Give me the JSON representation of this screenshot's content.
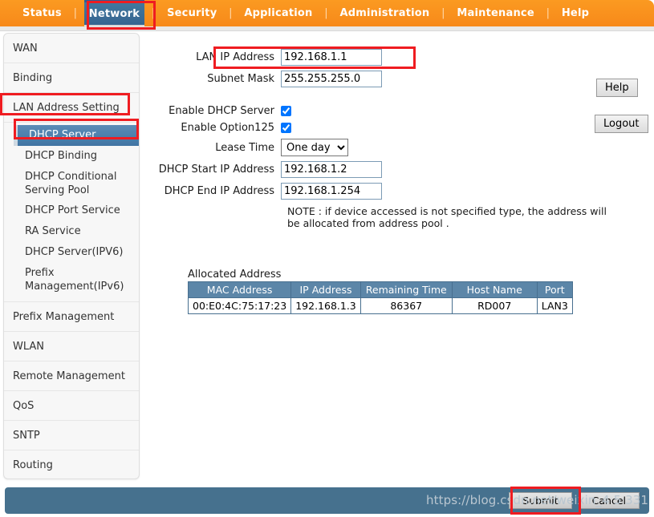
{
  "topnav": {
    "separator": "|",
    "items": [
      {
        "label": "Status",
        "active": false
      },
      {
        "label": "Network",
        "active": true
      },
      {
        "label": "Security",
        "active": false
      },
      {
        "label": "Application",
        "active": false
      },
      {
        "label": "Administration",
        "active": false
      },
      {
        "label": "Maintenance",
        "active": false
      },
      {
        "label": "Help",
        "active": false
      }
    ],
    "highlight_color": "#ef1c21",
    "bar_color": "#f7941e",
    "active_tab_color": "#3b72a4"
  },
  "sidebar": {
    "items": [
      {
        "label": "WAN"
      },
      {
        "label": "Binding"
      },
      {
        "label": "LAN Address Setting",
        "highlighted": true
      },
      {
        "label": "Prefix Management"
      },
      {
        "label": "WLAN"
      },
      {
        "label": "Remote Management"
      },
      {
        "label": "QoS"
      },
      {
        "label": "SNTP"
      },
      {
        "label": "Routing"
      }
    ],
    "sub_items": [
      {
        "label": "DHCP Server",
        "selected": true
      },
      {
        "label": "DHCP Binding",
        "selected": false
      },
      {
        "label": "DHCP Conditional Serving Pool",
        "selected": false
      },
      {
        "label": "DHCP Port Service",
        "selected": false
      },
      {
        "label": "RA Service",
        "selected": false
      },
      {
        "label": "DHCP Server(IPV6)",
        "selected": false
      },
      {
        "label": "Prefix Management(IPv6)",
        "selected": false
      }
    ]
  },
  "form": {
    "lan_ip_label": "LAN IP Address",
    "lan_ip_value": "192.168.1.1",
    "subnet_label": "Subnet Mask",
    "subnet_value": "255.255.255.0",
    "enable_dhcp_label": "Enable DHCP Server",
    "enable_dhcp_checked": true,
    "enable_option125_label": "Enable Option125",
    "enable_option125_checked": true,
    "lease_time_label": "Lease Time",
    "lease_time_value": "One day",
    "lease_time_options": [
      "One day"
    ],
    "dhcp_start_label": "DHCP Start IP Address",
    "dhcp_start_value": "192.168.1.2",
    "dhcp_end_label": "DHCP End IP Address",
    "dhcp_end_value": "192.168.1.254",
    "note": "NOTE : if device accessed is not specified type, the address will be allocated from address pool ."
  },
  "table": {
    "title": "Allocated Address",
    "headers": [
      "MAC Address",
      "IP Address",
      "Remaining Time",
      "Host Name",
      "Port"
    ],
    "rows": [
      [
        "00:E0:4C:75:17:23",
        "192.168.1.3",
        "86367",
        "RD007",
        "LAN3"
      ]
    ],
    "header_color": "#5c86a8"
  },
  "side_buttons": {
    "help": "Help",
    "logout": "Logout"
  },
  "footer": {
    "submit": "Submit",
    "cancel": "Cancel",
    "watermark": "https://blog.csdn.net/weixin_4  5  331",
    "bar_color": "#46718e"
  }
}
